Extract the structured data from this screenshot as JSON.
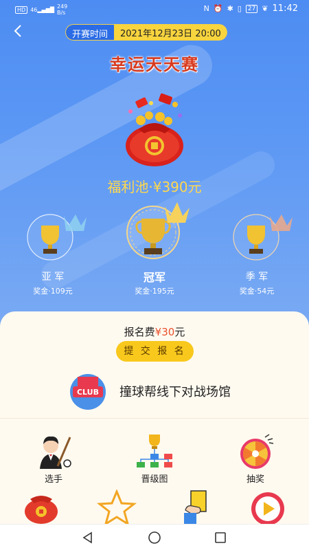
{
  "status_bar": {
    "hd": "HD",
    "signal": "46",
    "net_speed_value": "249",
    "net_speed_unit": "B/s",
    "nfc_icon": "N",
    "battery": "27",
    "time": "11:42"
  },
  "header": {
    "time_label": "开赛时间",
    "time_value": "2021年12月23日 20:00"
  },
  "title": "幸运天天赛",
  "prize_pool": "福利池·¥390元",
  "ranks": {
    "second": {
      "label": "亚 军",
      "prize": "奖金·109元"
    },
    "first": {
      "label": "冠军",
      "prize": "奖金·195元"
    },
    "third": {
      "label": "季 军",
      "prize": "奖金·54元"
    }
  },
  "fee": {
    "prefix": "报名费",
    "amount": "¥30",
    "suffix": "元"
  },
  "signup_button": "提 交 报 名",
  "club": {
    "logo_text": "CLUB",
    "name": "撞球帮线下对战场馆"
  },
  "grid": [
    {
      "label": "选手",
      "icon": "player-icon"
    },
    {
      "label": "晋级图",
      "icon": "bracket-icon"
    },
    {
      "label": "抽奖",
      "icon": "lottery-wheel-icon"
    }
  ],
  "colors": {
    "hero_blue": "#4d8cf2",
    "pill_blue": "#2b6ce6",
    "gold": "#f8c81d",
    "prize_yellow": "#ffd84d",
    "title_red": "#d83a1e",
    "card_bg": "#fffaf0"
  }
}
